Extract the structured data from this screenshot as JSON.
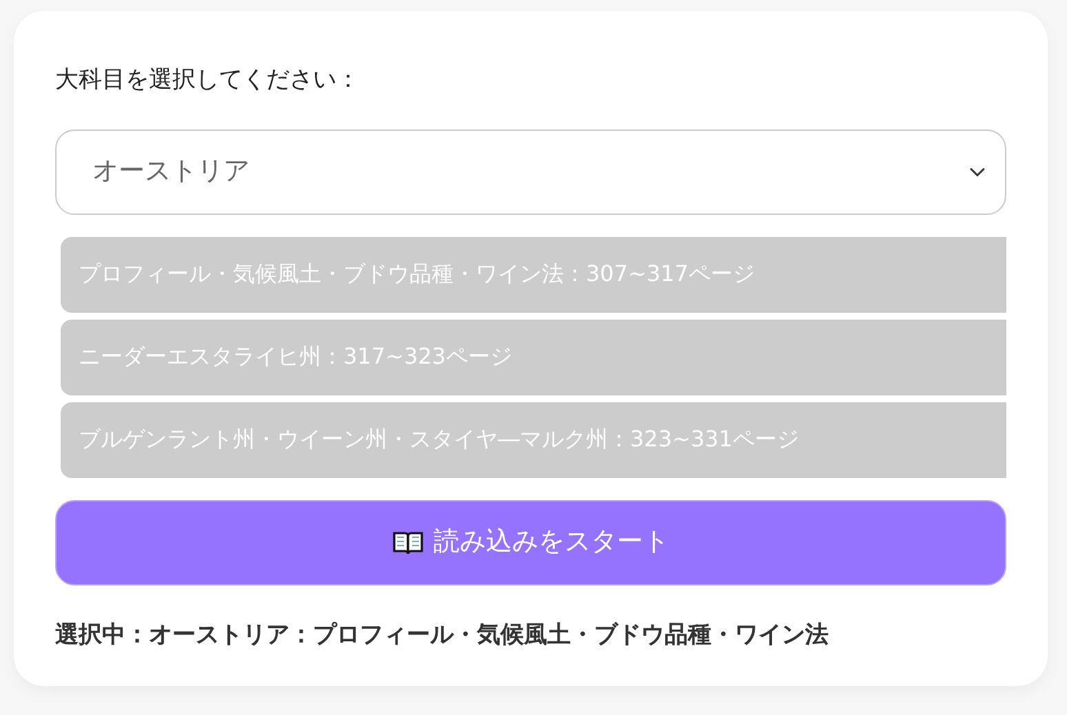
{
  "prompt": "大科目を選択してください：",
  "select": {
    "value": "オーストリア"
  },
  "sections": [
    {
      "label": "プロフィール・気候風土・ブドウ品種・ワイン法：307~317ページ"
    },
    {
      "label": "ニーダーエスタライヒ州：317~323ページ"
    },
    {
      "label": "ブルゲンラント州・ウイーン州・スタイヤ―マルク州：323~331ページ"
    }
  ],
  "start_button": {
    "label": "読み込みをスタート"
  },
  "selection_status": "選択中：オーストリア：プロフィール・気候風土・ブドウ品種・ワイン法"
}
